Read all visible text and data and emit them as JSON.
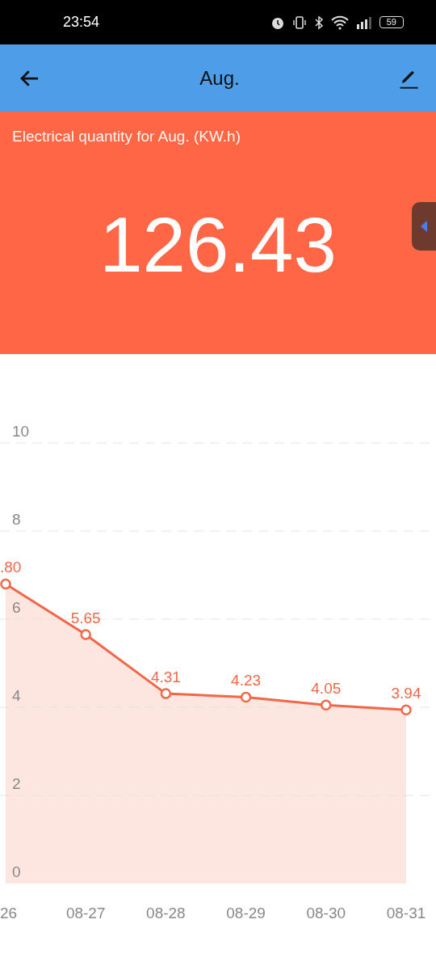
{
  "status_bar": {
    "time": "23:54",
    "battery": "59"
  },
  "app_bar": {
    "title": "Aug."
  },
  "summary": {
    "caption": "Electrical quantity for Aug. (KW.h)",
    "total": "126.43"
  },
  "chart": {
    "chart_data": {
      "type": "area",
      "categories": [
        "26",
        "08-27",
        "08-28",
        "08-29",
        "08-30",
        "08-31"
      ],
      "grid": true,
      "series": [
        {
          "color": "#f06848",
          "values": [
            6.8,
            5.65,
            4.31,
            4.23,
            4.05,
            3.94
          ]
        }
      ],
      "value_labels": [
        ".80",
        "5.65",
        "4.31",
        "4.23",
        "4.05",
        "3.94"
      ],
      "ylim": [
        0,
        10
      ],
      "yticks": [
        0,
        2,
        4,
        6,
        8,
        10
      ]
    }
  }
}
